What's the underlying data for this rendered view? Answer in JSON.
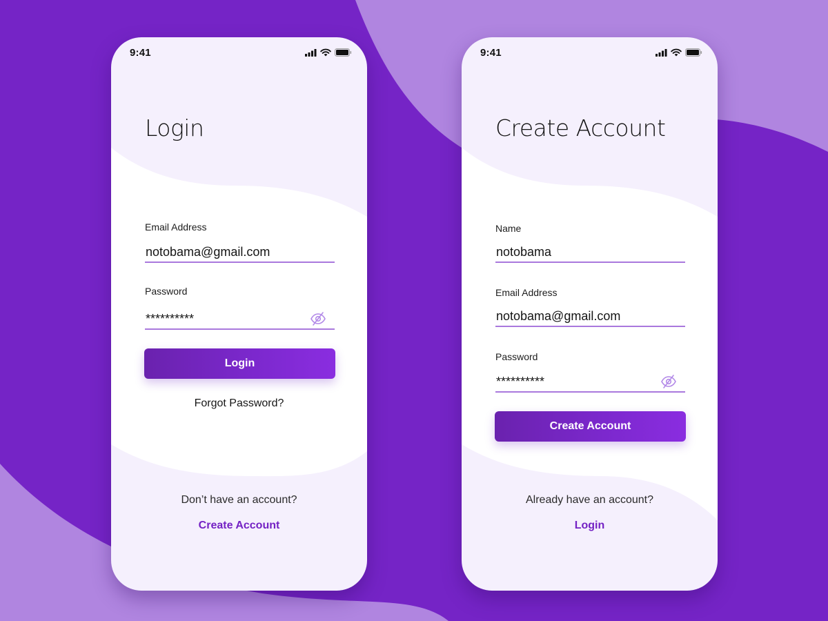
{
  "colors": {
    "background": "#7524c6",
    "background_light": "#b085e0",
    "phone_bg": "#f5f0fd",
    "accent": "#7422c4",
    "underline": "#a978dd"
  },
  "status_bar": {
    "time": "9:41",
    "icons": [
      "signal-icon",
      "wifi-icon",
      "battery-icon"
    ]
  },
  "login_screen": {
    "title": "Login",
    "fields": [
      {
        "label": "Email Address",
        "value": "notobama@gmail.com",
        "type": "email"
      },
      {
        "label": "Password",
        "value": "**********",
        "type": "password",
        "icon": "eye-off-icon"
      }
    ],
    "primary_button": "Login",
    "forgot_link": "Forgot Password?",
    "footer_prompt": "Don’t have an account?",
    "footer_link": "Create Account"
  },
  "signup_screen": {
    "title": "Create Account",
    "fields": [
      {
        "label": "Name",
        "value": "notobama",
        "type": "text"
      },
      {
        "label": "Email Address",
        "value": "notobama@gmail.com",
        "type": "email"
      },
      {
        "label": "Password",
        "value": "**********",
        "type": "password",
        "icon": "eye-off-icon"
      }
    ],
    "primary_button": "Create Account",
    "footer_prompt": "Already have an account?",
    "footer_link": "Login"
  }
}
